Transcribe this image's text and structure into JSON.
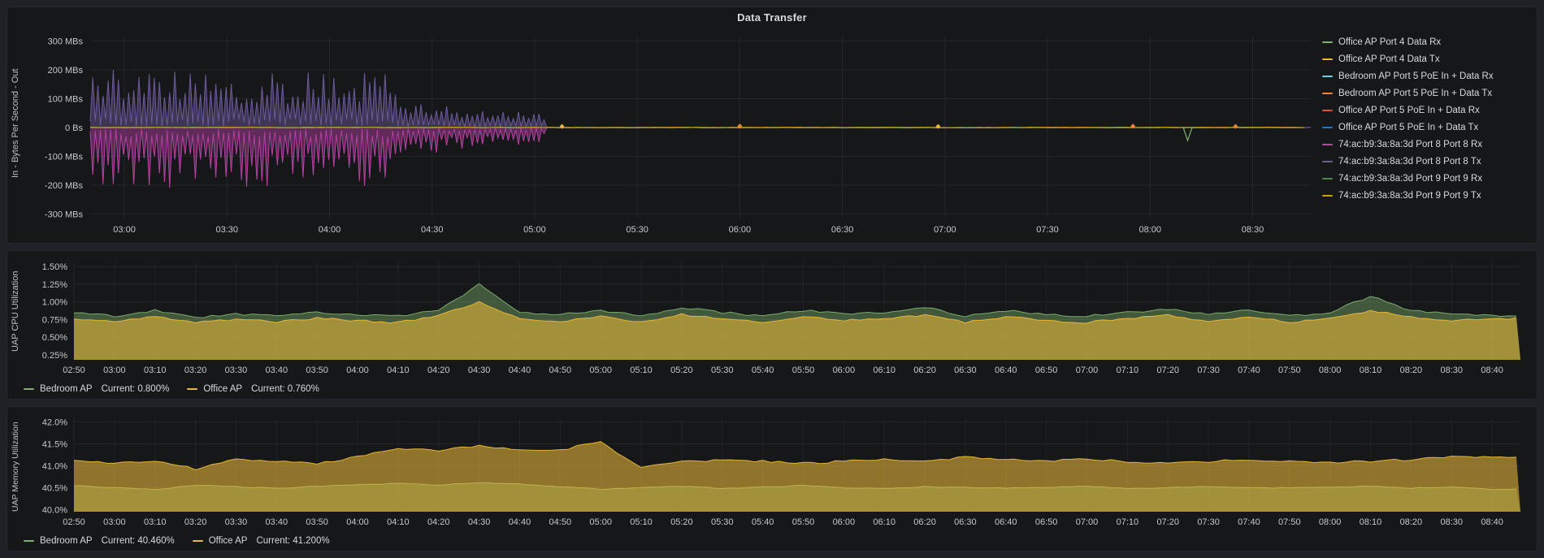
{
  "labels": {
    "legend_stat_label": "Current:"
  },
  "chart_data": [
    {
      "id": "transfer",
      "type": "line",
      "title": "Data Transfer",
      "ylabel": "In - Bytes Per Second - Out",
      "y_unit": "megabytes per second",
      "ylim_mb": [
        -300,
        300
      ],
      "y_tick_labels": [
        "300 MBs",
        "200 MBs",
        "100 MBs",
        "0 Bs",
        "-100 MBs",
        "-200 MBs",
        "-300 MBs"
      ],
      "y_tick_values_mb": [
        300,
        200,
        100,
        0,
        -100,
        -200,
        -300
      ],
      "x_start": "02:50",
      "x_end": "08:47",
      "x_tick_labels": [
        "03:00",
        "03:30",
        "04:00",
        "04:30",
        "05:00",
        "05:30",
        "06:00",
        "06:30",
        "07:00",
        "07:30",
        "08:00",
        "08:30"
      ],
      "legend_position": "right",
      "grid": true,
      "series": [
        {
          "name": "Office AP Port 4 Data Rx",
          "color": "#7EB26D",
          "pattern": "flat_zero"
        },
        {
          "name": "Office AP Port 4 Data Tx",
          "color": "#EAB839",
          "pattern": "flat_zero"
        },
        {
          "name": "Bedroom AP Port 5 PoE In + Data Rx",
          "color": "#6ED0E0",
          "pattern": "flat_zero"
        },
        {
          "name": "Bedroom AP Port 5 PoE In + Data Tx",
          "color": "#EF843C",
          "pattern": "flat_zero"
        },
        {
          "name": "Office AP Port 5 PoE In + Data Rx",
          "color": "#E24D42",
          "pattern": "flat_zero"
        },
        {
          "name": "Office AP Port 5 PoE In + Data Tx",
          "color": "#1F78C1",
          "pattern": "flat_zero"
        },
        {
          "name": "74:ac:b9:3a:8a:3d Port 8 Port 8 Rx",
          "color": "#BA43A9",
          "pattern": "oscillation_negative",
          "envelope_mb": [
            [
              "02:50",
              215
            ],
            [
              "04:18",
              215
            ],
            [
              "04:22",
              95
            ],
            [
              "05:02",
              60
            ],
            [
              "05:04",
              1
            ],
            [
              "08:47",
              1
            ]
          ]
        },
        {
          "name": "74:ac:b9:3a:8a:3d Port 8 Port 8 Tx",
          "color": "#705DA0",
          "pattern": "oscillation_positive",
          "envelope_mb": [
            [
              "02:50",
              200
            ],
            [
              "04:18",
              200
            ],
            [
              "04:22",
              85
            ],
            [
              "05:02",
              55
            ],
            [
              "05:04",
              1
            ],
            [
              "08:47",
              1
            ]
          ]
        },
        {
          "name": "74:ac:b9:3a:8a:3d Port 9 Port 9 Rx",
          "color": "#508642",
          "pattern": "flat_zero"
        },
        {
          "name": "74:ac:b9:3a:8a:3d Port 9 Port 9 Tx",
          "color": "#CCA300",
          "pattern": "flat_zero"
        }
      ],
      "point_events": [
        {
          "time": "05:08",
          "value_mb": 4,
          "color": "#EAB839"
        },
        {
          "time": "06:00",
          "value_mb": 5,
          "color": "#EF843C"
        },
        {
          "time": "06:58",
          "value_mb": 4,
          "color": "#EAB839"
        },
        {
          "time": "07:55",
          "value_mb": 5,
          "color": "#EF843C"
        },
        {
          "time": "08:11",
          "value_mb": -45,
          "color": "#7EB26D"
        },
        {
          "time": "08:25",
          "value_mb": 4,
          "color": "#EF843C"
        }
      ]
    },
    {
      "id": "cpu",
      "type": "area",
      "axis_label": "UAP CPU Utilization",
      "ylim": [
        0.18,
        1.56
      ],
      "y_tick_labels": [
        "1.50%",
        "1.25%",
        "1.00%",
        "0.75%",
        "0.50%",
        "0.25%"
      ],
      "y_tick_values": [
        1.5,
        1.25,
        1.0,
        0.75,
        0.5,
        0.25
      ],
      "x_end": "08:47",
      "categories": [
        "02:50",
        "03:00",
        "03:10",
        "03:20",
        "03:30",
        "03:40",
        "03:50",
        "04:00",
        "04:10",
        "04:20",
        "04:30",
        "04:40",
        "04:50",
        "05:00",
        "05:10",
        "05:20",
        "05:30",
        "05:40",
        "05:50",
        "06:00",
        "06:10",
        "06:20",
        "06:30",
        "06:40",
        "06:50",
        "07:00",
        "07:10",
        "07:20",
        "07:30",
        "07:40",
        "07:50",
        "08:00",
        "08:10",
        "08:20",
        "08:30",
        "08:40"
      ],
      "series": [
        {
          "name": "Bedroom AP",
          "color": "#7EB26D",
          "current": "0.800%",
          "values": [
            0.85,
            0.8,
            0.88,
            0.78,
            0.83,
            0.8,
            0.85,
            0.82,
            0.8,
            0.88,
            1.25,
            0.85,
            0.82,
            0.88,
            0.8,
            0.92,
            0.85,
            0.8,
            0.88,
            0.83,
            0.85,
            0.92,
            0.8,
            0.88,
            0.82,
            0.8,
            0.85,
            0.9,
            0.82,
            0.88,
            0.8,
            0.85,
            1.08,
            0.88,
            0.83,
            0.8
          ]
        },
        {
          "name": "Office AP",
          "color": "#EAB839",
          "current": "0.760%",
          "values": [
            0.76,
            0.72,
            0.79,
            0.71,
            0.75,
            0.72,
            0.77,
            0.73,
            0.71,
            0.8,
            1.0,
            0.76,
            0.73,
            0.79,
            0.71,
            0.82,
            0.76,
            0.72,
            0.79,
            0.74,
            0.76,
            0.82,
            0.71,
            0.79,
            0.73,
            0.71,
            0.76,
            0.81,
            0.73,
            0.79,
            0.71,
            0.76,
            0.88,
            0.79,
            0.74,
            0.76
          ]
        }
      ]
    },
    {
      "id": "memory",
      "type": "area",
      "axis_label": "UAP Memory Utilization",
      "ylim": [
        39.95,
        42.08
      ],
      "y_tick_labels": [
        "42.0%",
        "41.5%",
        "41.0%",
        "40.5%",
        "40.0%"
      ],
      "y_tick_values": [
        42.0,
        41.5,
        41.0,
        40.5,
        40.0
      ],
      "x_end": "08:47",
      "categories": [
        "02:50",
        "03:00",
        "03:10",
        "03:20",
        "03:30",
        "03:40",
        "03:50",
        "04:00",
        "04:10",
        "04:20",
        "04:30",
        "04:40",
        "04:50",
        "05:00",
        "05:10",
        "05:20",
        "05:30",
        "05:40",
        "05:50",
        "06:00",
        "06:10",
        "06:20",
        "06:30",
        "06:40",
        "06:50",
        "07:00",
        "07:10",
        "07:20",
        "07:30",
        "07:40",
        "07:50",
        "08:00",
        "08:10",
        "08:20",
        "08:30",
        "08:40"
      ],
      "series": [
        {
          "name": "Bedroom AP",
          "color": "#7EB26D",
          "current": "40.460%",
          "values": [
            40.55,
            40.5,
            40.46,
            40.55,
            40.52,
            40.48,
            40.53,
            40.56,
            40.6,
            40.56,
            40.62,
            40.58,
            40.52,
            40.46,
            40.5,
            40.53,
            40.48,
            40.51,
            40.55,
            40.5,
            40.48,
            40.52,
            40.5,
            40.49,
            40.51,
            40.53,
            40.48,
            40.5,
            40.52,
            40.5,
            40.49,
            40.51,
            40.53,
            40.49,
            40.51,
            40.46
          ]
        },
        {
          "name": "Office AP",
          "color": "#EAB839",
          "current": "41.200%",
          "values": [
            41.1,
            41.05,
            41.12,
            40.92,
            41.15,
            41.1,
            41.06,
            41.2,
            41.4,
            41.35,
            41.45,
            41.38,
            41.35,
            41.55,
            40.95,
            41.08,
            41.15,
            41.1,
            41.05,
            41.1,
            41.15,
            41.1,
            41.2,
            41.15,
            41.1,
            41.15,
            41.1,
            41.05,
            41.1,
            41.15,
            41.1,
            41.06,
            41.1,
            41.14,
            41.2,
            41.2
          ]
        }
      ]
    }
  ]
}
